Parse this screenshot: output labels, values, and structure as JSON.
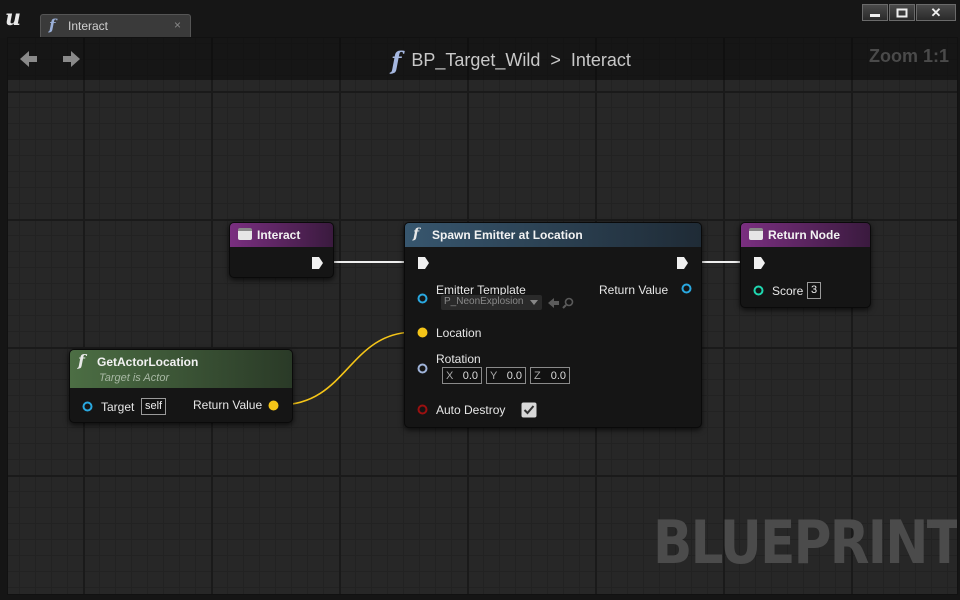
{
  "window": {
    "tab_label": "Interact",
    "tab_close": "×",
    "buttons": {
      "minimize": "▬",
      "maximize": "▭",
      "close": "✕"
    }
  },
  "toolbar": {
    "back_icon": "arrow-left-icon",
    "forward_icon": "arrow-right-icon",
    "breadcrumb": {
      "blueprint": "BP_Target_Wild",
      "separator": ">",
      "function": "Interact"
    },
    "zoom": "Zoom 1:1"
  },
  "watermark": "BLUEPRINT",
  "nodes": {
    "interact": {
      "title": "Interact",
      "color": "#6a2a6e"
    },
    "spawn_emitter": {
      "title": "Spawn Emitter at Location",
      "color": "#2e4a60",
      "pins": {
        "emitter_template": "Emitter Template",
        "emitter_value": "P_NeonExplosion",
        "return_value": "Return Value",
        "location": "Location",
        "rotation": "Rotation",
        "rotation_x": {
          "axis": "X",
          "value": "0.0"
        },
        "rotation_y": {
          "axis": "Y",
          "value": "0.0"
        },
        "rotation_z": {
          "axis": "Z",
          "value": "0.0"
        },
        "auto_destroy": "Auto Destroy",
        "auto_destroy_checked": true
      }
    },
    "return_node": {
      "title": "Return Node",
      "color": "#6a2a6e",
      "pins": {
        "score": "Score",
        "score_value": "3"
      }
    },
    "get_actor_location": {
      "title": "GetActorLocation",
      "subtitle": "Target is Actor",
      "color": "#3e5a38",
      "pins": {
        "target": "Target",
        "target_value": "self",
        "return_value": "Return Value"
      }
    }
  },
  "colors": {
    "exec_wire": "#f0f0f0",
    "vector_pin": "#f5c518",
    "object_pin": "#29a8e0",
    "rotator_pin": "#9fb3d9",
    "bool_pin": "#9a1010",
    "int_pin": "#1fd7b0"
  }
}
